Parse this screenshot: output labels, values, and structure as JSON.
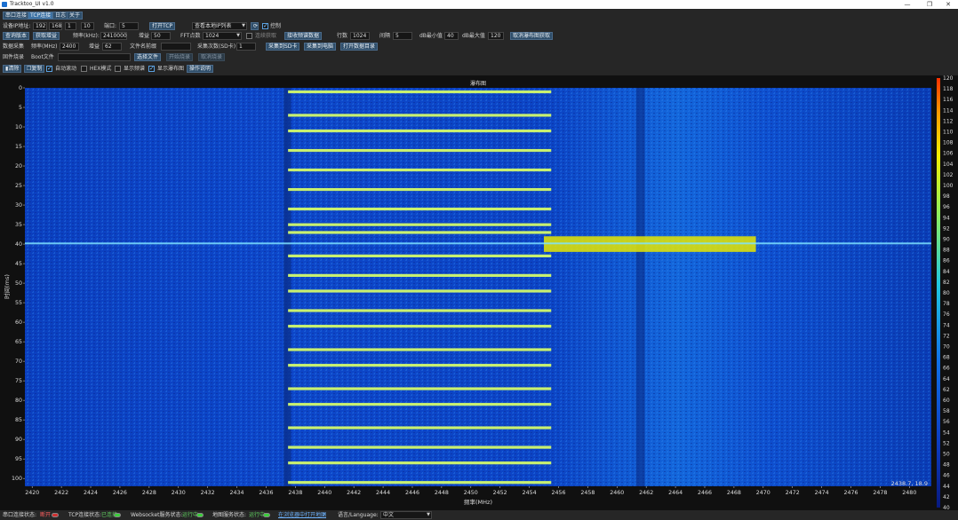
{
  "window": {
    "title": "Tracktoo_UI v1.0",
    "minimize": "—",
    "maximize": "❐",
    "close": "✕"
  },
  "tabs": [
    "串口连接",
    "TCP连接",
    "日志",
    "关于"
  ],
  "row1": {
    "ip_label": "设备IP地址:",
    "ip": [
      "192",
      "168",
      "1",
      "10"
    ],
    "port_label": "端口:",
    "port": "5",
    "open_tcp": "打开TCP",
    "query_ip": "查看本地IP列表",
    "control": "控制"
  },
  "row2": {
    "full_version": "查询版本",
    "get_gain": "获取增益",
    "freq_label": "频率(kHz):",
    "freq": "2410000",
    "gain_label": "增益",
    "gain": "50",
    "fft_label": "FFT点数",
    "fft": "1024",
    "continuous": "连续获取",
    "receive": "接收频谱数据",
    "rows_label": "行数",
    "rows": "1024",
    "interval_label": "间隔",
    "interval": "5",
    "dbmin_label": "dB最小值",
    "dbmin": "40",
    "dbmax_label": "dB最大值",
    "dbmax": "120",
    "cancel_get": "取消瀑布图获取"
  },
  "row3": {
    "section": "数据采集",
    "freq_label": "频率(MHz)",
    "freq": "2400",
    "gain_label": "增益",
    "gain": "62",
    "name_label": "文件名前缀",
    "name": "",
    "count_label": "采集次数(SD卡)",
    "count": "1",
    "to_sd": "采集到SD卡",
    "to_pc": "采集到电脑",
    "open_dir": "打开数据目录"
  },
  "row4": {
    "section": "固件烧录",
    "boot_label": "Boot文件",
    "boot": "",
    "choose": "选择文件",
    "start": "开始烧录",
    "cancel": "取消烧录"
  },
  "row5": {
    "clear": "清除",
    "copy": "复制",
    "autoscroll": "自动滚动",
    "hex": "HEX模式",
    "show_spec": "显示频谱",
    "show_wf": "显示瀑布图",
    "guide": "操作说明"
  },
  "chart_data": {
    "type": "heatmap",
    "title": "瀑布图",
    "xlabel": "频率(MHz)",
    "ylabel": "时间(ms)",
    "xlim": [
      2419.5,
      2481.5
    ],
    "ylim": [
      0,
      102
    ],
    "x_ticks": [
      2420,
      2422,
      2424,
      2426,
      2428,
      2430,
      2432,
      2434,
      2436,
      2438,
      2440,
      2442,
      2444,
      2446,
      2448,
      2450,
      2452,
      2454,
      2456,
      2458,
      2460,
      2462,
      2464,
      2466,
      2468,
      2470,
      2472,
      2474,
      2476,
      2478,
      2480
    ],
    "y_ticks": [
      0,
      5,
      10,
      15,
      20,
      25,
      30,
      35,
      40,
      45,
      50,
      55,
      60,
      65,
      70,
      75,
      80,
      85,
      90,
      95,
      100
    ],
    "colorbar_ticks": [
      120,
      118,
      116,
      114,
      112,
      110,
      108,
      106,
      104,
      102,
      100,
      98,
      96,
      94,
      92,
      90,
      88,
      86,
      84,
      82,
      80,
      78,
      76,
      74,
      72,
      70,
      68,
      66,
      64,
      62,
      60,
      58,
      56,
      54,
      52,
      50,
      48,
      46,
      44,
      42,
      40
    ],
    "colorbar_range": [
      40,
      120
    ],
    "cursor_readout": "2438.7, 18.9",
    "signal_bursts": {
      "freq_range_mhz": [
        2437.5,
        2455.5
      ],
      "rows_ms": [
        1,
        7,
        11,
        16,
        21,
        26,
        31,
        35,
        37,
        43,
        48,
        52,
        57,
        61,
        67,
        71,
        77,
        81,
        87,
        92,
        96,
        101
      ]
    },
    "wide_signal": {
      "freq_range_mhz": [
        2455,
        2469.5
      ],
      "rows_ms": [
        38,
        42
      ]
    }
  },
  "status": {
    "serial_label": "串口连接状态:",
    "serial": "断开",
    "tcp_label": "TCP连接状态:",
    "tcp": "已连接",
    "ws_label": "Websocket服务状态:",
    "ws": "运行中",
    "map_label": "地图服务状态:",
    "map": "运行中",
    "open_map": "在浏览器中打开地图",
    "lang_label": "语言/Language:",
    "lang": "中文"
  }
}
